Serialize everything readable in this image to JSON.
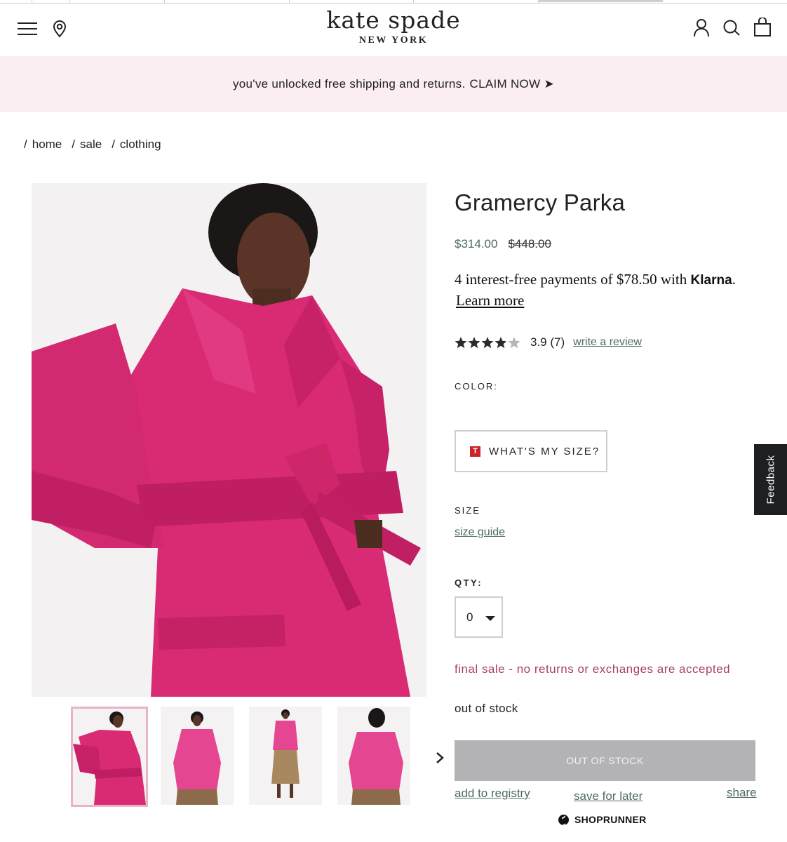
{
  "brand": {
    "name": "kate spade",
    "subtitle": "NEW YORK"
  },
  "header_icons": [
    "menu-icon",
    "location-pin-icon",
    "account-icon",
    "search-icon",
    "shopping-bag-icon"
  ],
  "promo": {
    "text": "you've unlocked free shipping and returns.",
    "cta": "CLAIM NOW ➤"
  },
  "breadcrumb": [
    {
      "label": "home"
    },
    {
      "label": "sale"
    },
    {
      "label": "clothing"
    }
  ],
  "product": {
    "title": "Gramercy Parka",
    "price_sale": "$314.00",
    "price_original": "$448.00",
    "klarna_text": "4 interest-free payments of $78.50 with",
    "klarna_brand": "Klarna",
    "klarna_period": ".",
    "klarna_link": "Learn more",
    "rating_value": 3.9,
    "rating_text": "3.9 (7)",
    "write_review": "write a review",
    "color_label": "COLOR:",
    "size_button": "WHAT'S MY SIZE?",
    "size_button_logo": "T",
    "size_label": "SIZE",
    "size_guide": "size guide",
    "qty_label": "QTY:",
    "qty_value": "0",
    "final_sale": "final sale - no returns or exchanges are accepted",
    "stock_status": "out of stock",
    "oos_button": "OUT OF STOCK",
    "add_to_registry": "add to registry",
    "save_for_later": "save for later",
    "share": "share",
    "shoprunner": "SHOPRUNNER"
  },
  "colors": {
    "accent_text": "#4c6b66",
    "sale_notice": "#a83f6a",
    "promo_bg": "#fbeef2",
    "jacket": "#d92a74",
    "oos_button": "#b3b3b6"
  },
  "feedback_tab": "Feedback"
}
